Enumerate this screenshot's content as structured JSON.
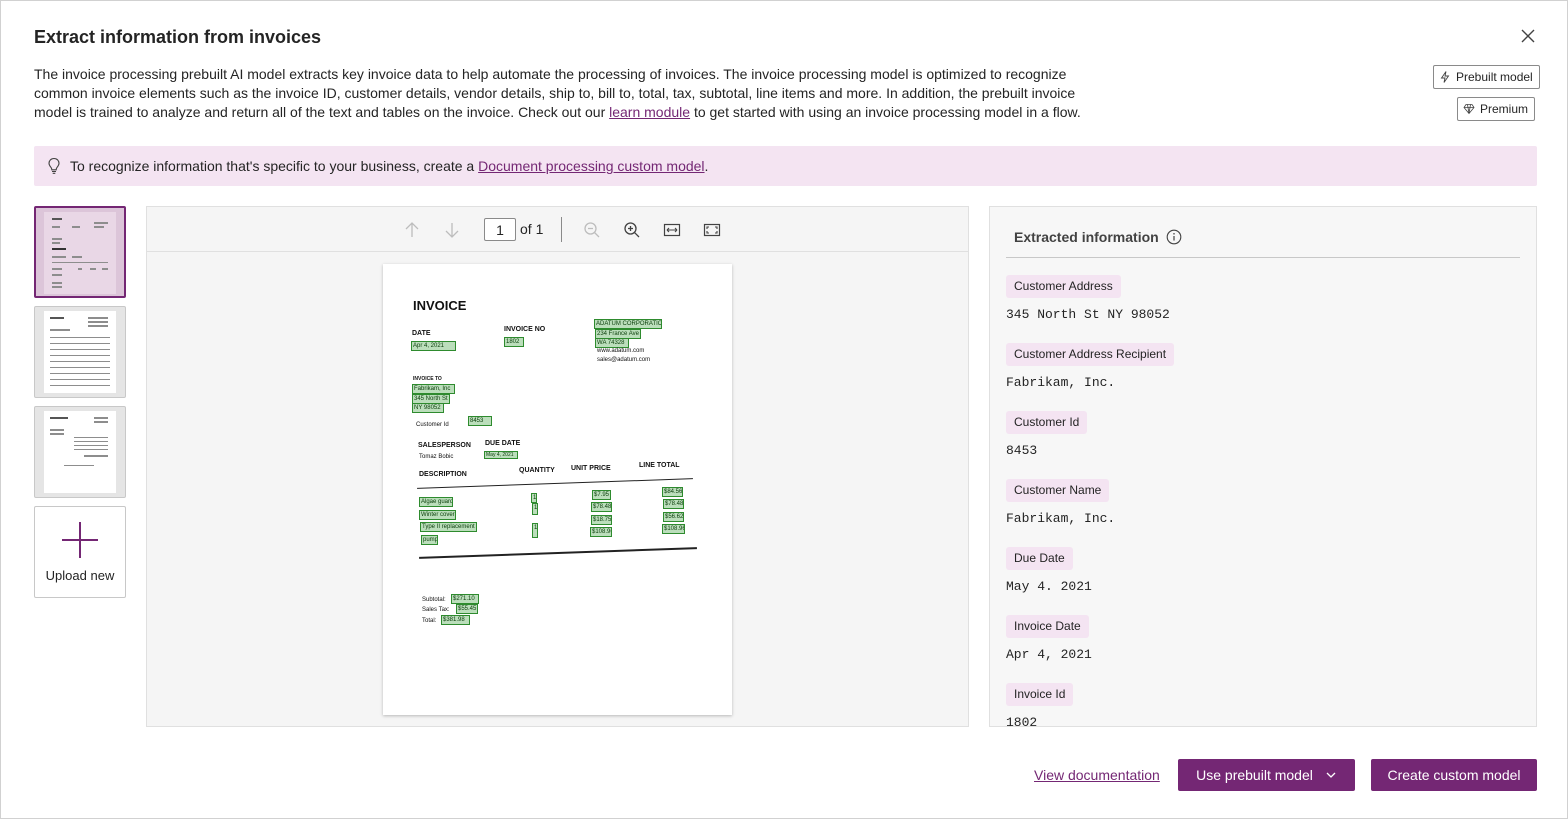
{
  "dialog": {
    "title": "Extract information from invoices",
    "description_before": "The invoice processing prebuilt AI model extracts key invoice data to help automate the processing of invoices. The invoice processing model is optimized to recognize common invoice elements such as the invoice ID, customer details, vendor details, ship to, bill to, total, tax, subtotal, line items and more. In addition, the prebuilt invoice model is trained to analyze and return all of the text and tables on the invoice. Check out our ",
    "description_link": "learn module",
    "description_after": " to get started with using an invoice processing model in a flow.",
    "badges": {
      "prebuilt": "Prebuilt model",
      "premium": "Premium"
    }
  },
  "banner": {
    "text_before": "To recognize information that's specific to your business, create a ",
    "link": "Document processing custom model",
    "text_after": "."
  },
  "thumbnails": {
    "upload_label": "Upload new",
    "selected_index": 0
  },
  "viewer": {
    "page_current": "1",
    "page_total_label": "of 1"
  },
  "document": {
    "heading": "INVOICE",
    "date_label": "DATE",
    "date_value": "Apr 4, 2021",
    "invoice_no_label": "INVOICE NO",
    "invoice_no_value": "1802",
    "vendor_name": "ADATUM CORPORATION",
    "vendor_street": "234 France Ave",
    "vendor_city": "WA 74328",
    "vendor_web": "www.adatum.com",
    "vendor_email": "sales@adatum.com",
    "invoice_to_label": "INVOICE TO",
    "customer_name": "Fabrikam, Inc",
    "customer_street": "345 North St",
    "customer_city": "NY 98052",
    "customer_id_label": "Customer Id",
    "customer_id_value": "8453",
    "salesperson_label": "SALESPERSON",
    "salesperson_value": "Tomaz Bobic",
    "due_date_label": "DUE DATE",
    "due_date_value": "May 4, 2021",
    "col_description": "DESCRIPTION",
    "col_quantity": "QUANTITY",
    "col_unit_price": "UNIT PRICE",
    "col_line_total": "LINE TOTAL",
    "items": [
      {
        "desc": "Algae guard",
        "qty": "1",
        "price": "$7.95",
        "total": "$84.56"
      },
      {
        "desc": "Winter cover",
        "qty": "1",
        "price": "$78.48",
        "total": "$78.48"
      },
      {
        "desc": "Type II replacement",
        "qty": "1",
        "price": "$18.75",
        "total": "$56.62"
      },
      {
        "desc": "pump",
        "qty": "1",
        "price": "$108.96",
        "total": "$108.96"
      }
    ],
    "subtotal_label": "Subtotal:",
    "subtotal_value": "$271.10",
    "tax_label": "Sales Tax:",
    "tax_value": "$55.45",
    "total_label": "Total:",
    "total_value": "$381.98"
  },
  "extracted": {
    "title": "Extracted information",
    "fields": [
      {
        "label": "Customer Address",
        "value": "345 North St NY 98052"
      },
      {
        "label": "Customer Address Recipient",
        "value": "Fabrikam, Inc."
      },
      {
        "label": "Customer Id",
        "value": "8453"
      },
      {
        "label": "Customer Name",
        "value": "Fabrikam, Inc."
      },
      {
        "label": "Due Date",
        "value": "May 4. 2021"
      },
      {
        "label": "Invoice Date",
        "value": "Apr 4, 2021"
      },
      {
        "label": "Invoice Id",
        "value": "1802"
      }
    ]
  },
  "footer": {
    "view_docs": "View documentation",
    "use_prebuilt": "Use prebuilt model",
    "create_custom": "Create custom model"
  },
  "colors": {
    "accent": "#742774",
    "banner_bg": "#f4e4f2",
    "highlight_box": "#2e8b2e"
  }
}
